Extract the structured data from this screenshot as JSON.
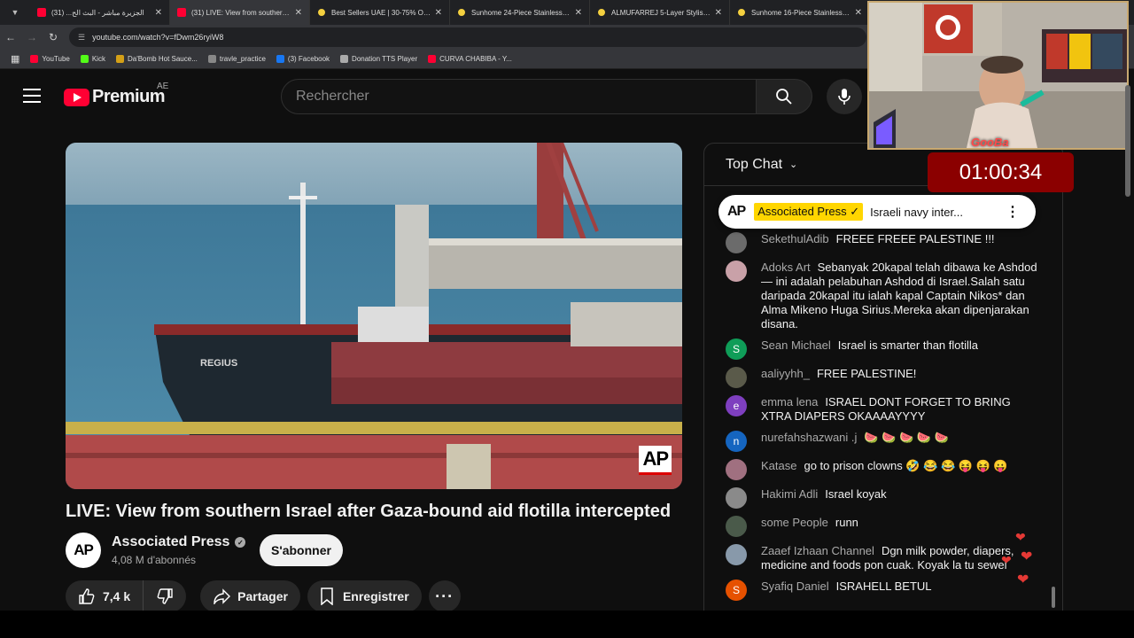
{
  "browser": {
    "tabs": [
      {
        "title": "الجزيرة مباشر - البث الح... (31)",
        "favicon": "youtube",
        "active": false
      },
      {
        "title": "(31) LIVE: View from southern Isr...",
        "favicon": "youtube",
        "active": true
      },
      {
        "title": "Best Sellers UAE | 30-75% OFF |",
        "favicon": "smiley",
        "active": false
      },
      {
        "title": "Sunhome 24-Piece Stainless Ste...",
        "favicon": "smiley",
        "active": false
      },
      {
        "title": "ALMUFARREJ 5-Layer Stylish Sh...",
        "favicon": "smiley",
        "active": false
      },
      {
        "title": "Sunhome 16-Piece Stainless Ste...",
        "favicon": "smiley",
        "active": false
      }
    ],
    "url": "youtube.com/watch?v=fDwm26ryiW8",
    "bookmarks": [
      {
        "label": "YouTube",
        "color": "#ff0033"
      },
      {
        "label": "Kick",
        "color": "#53fc18"
      },
      {
        "label": "Da'Bomb Hot Sauce...",
        "color": "#d4a017"
      },
      {
        "label": "travle_practice",
        "color": "#888888"
      },
      {
        "label": "(3) Facebook",
        "color": "#1877f2"
      },
      {
        "label": "Donation TTS Player",
        "color": "#aaaaaa"
      },
      {
        "label": "CURVA CHABIBA - Y...",
        "color": "#ff0033"
      }
    ]
  },
  "masthead": {
    "logo_text": "Premium",
    "country_code": "AE",
    "search_placeholder": "Rechercher"
  },
  "video": {
    "title": "LIVE: View from southern Israel after Gaza-bound aid flotilla intercepted",
    "watermark": "AP",
    "ship_name": "REGIUS",
    "channel": {
      "name": "Associated Press",
      "avatar_text": "AP",
      "subscribers": "4,08 M d'abonnés",
      "subscribe_label": "S'abonner"
    },
    "actions": {
      "likes": "7,4 k",
      "share_label": "Partager",
      "save_label": "Enregistrer"
    }
  },
  "chat": {
    "header": "Top Chat",
    "pinned": {
      "avatar_text": "AP",
      "author": "Associated Press ✓",
      "text": "Israeli navy inter..."
    },
    "messages": [
      {
        "author": "SekethulAdib",
        "text": "FREEE FREEE PALESTINE !!!",
        "avatar_color": "#6b6b6b",
        "initial": ""
      },
      {
        "author": "Adoks Art",
        "text": "Sebanyak 20kapal telah dibawa ke Ashdod — ini adalah pelabuhan Ashdod di Israel.Salah satu daripada 20kapal itu ialah kapal Captain Nikos* dan Alma Mikeno Huga Sirius.Mereka akan dipenjarakan disana.",
        "avatar_color": "#c9a1a8",
        "initial": ""
      },
      {
        "author": "Sean Michael",
        "text": "Israel is smarter than flotilla",
        "avatar_color": "#0f9d58",
        "initial": "S"
      },
      {
        "author": "aaliyyhh_",
        "text": "FREE PALESTINE!",
        "avatar_color": "#5a5a4a",
        "initial": ""
      },
      {
        "author": "emma lena",
        "text": "ISRAEL DONT FORGET TO BRING XTRA DIAPERS OKAAAAYYYY",
        "avatar_color": "#7e3fbf",
        "initial": "e"
      },
      {
        "author": "nurefahshazwani .j",
        "text": "🍉 🍉 🍉 🍉 🍉",
        "avatar_color": "#1565c0",
        "initial": "n"
      },
      {
        "author": "Katase",
        "text": "go to prison clowns 🤣 😂 😂 😝 😝 😛",
        "avatar_color": "#a07080",
        "initial": ""
      },
      {
        "author": "Hakimi Adli",
        "text": "Israel koyak",
        "avatar_color": "#8a8a8a",
        "initial": ""
      },
      {
        "author": "some People",
        "text": "runn",
        "avatar_color": "#4a5a4a",
        "initial": ""
      },
      {
        "author": "Zaaef Izhaan Channel",
        "text": "Dgn milk powder, diapers, medicine and foods pon cuak. Koyak la tu sewel",
        "avatar_color": "#8899aa",
        "initial": ""
      },
      {
        "author": "Syafiq Daniel",
        "text": "ISRAHELL BETUL",
        "avatar_color": "#e65100",
        "initial": "S"
      }
    ]
  },
  "overlay": {
    "timer": "01:00:34",
    "cam_label": "GooBa"
  }
}
